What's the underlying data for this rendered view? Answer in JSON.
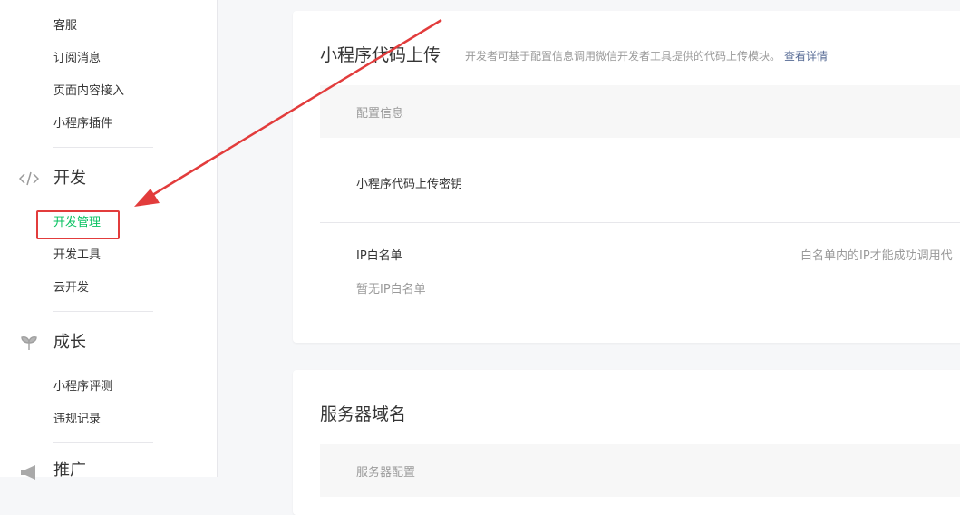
{
  "sidebar": {
    "items_top": [
      "客服",
      "订阅消息",
      "页面内容接入",
      "小程序插件"
    ],
    "dev_group": {
      "title": "开发",
      "icon": "code-icon",
      "items": [
        "开发管理",
        "开发工具",
        "云开发"
      ],
      "active": "开发管理"
    },
    "growth_group": {
      "title": "成长",
      "icon": "sprout-icon",
      "items": [
        "小程序评测",
        "违规记录"
      ]
    },
    "promo_group": {
      "title": "推广",
      "icon": "megaphone-icon"
    }
  },
  "upload_card": {
    "title": "小程序代码上传",
    "desc": "开发者可基于配置信息调用微信开发者工具提供的代码上传模块。",
    "link": "查看详情",
    "table_head": "配置信息",
    "secret_label": "小程序代码上传密钥",
    "ip_label": "IP白名单",
    "ip_empty": "暂无IP白名单",
    "ip_note": "白名单内的IP才能成功调用代"
  },
  "server_card": {
    "title": "服务器域名",
    "table_head": "服务器配置"
  },
  "colors": {
    "accent": "#07c160",
    "annotation": "#e23c3c",
    "link": "#576b95"
  }
}
